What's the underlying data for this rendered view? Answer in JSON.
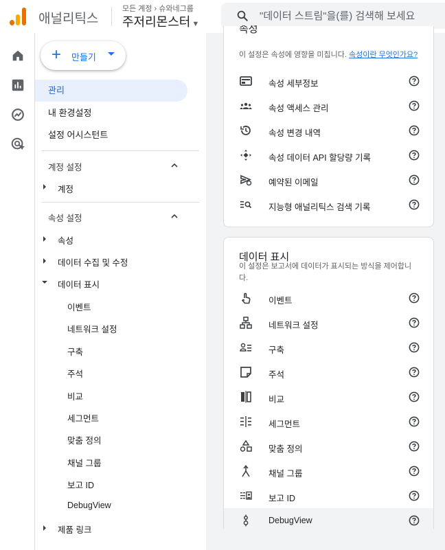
{
  "header": {
    "app_name": "애널리틱스",
    "breadcrumb": {
      "all_accounts": "모든 계정",
      "account": "슈와네그룹"
    },
    "property": "주저리몬스터",
    "search_placeholder": "\"데이터 스트림\"을(를) 검색해 보세요"
  },
  "rail": {
    "items": [
      "home-icon",
      "reports-icon",
      "explore-icon",
      "advertising-icon"
    ]
  },
  "nav": {
    "create_label": "만들기",
    "admin": "관리",
    "my_settings": "내 환경설정",
    "setup_assistant": "설정 어시스턴트",
    "account_settings": {
      "header": "계정 설정",
      "items": [
        "계정"
      ]
    },
    "property_settings": {
      "header": "속성 설정",
      "property": "속성",
      "data_collection": "데이터 수집 및 수정",
      "data_display": "데이터 표시",
      "data_display_items": [
        "이벤트",
        "네트워크 설정",
        "구축",
        "주석",
        "비교",
        "세그먼트",
        "맞춤 정의",
        "채널 그룹",
        "보고 ID",
        "DebugView"
      ],
      "product_links": "제품 링크"
    }
  },
  "property_card": {
    "title": "속성",
    "desc": "이 설정은 속성에 영향을 미칩니다.",
    "link": "속성이란 무엇인가요?",
    "rows": [
      {
        "icon": "property-details-icon",
        "label": "속성 세부정보"
      },
      {
        "icon": "property-access-icon",
        "label": "속성 액세스 관리"
      },
      {
        "icon": "change-history-icon",
        "label": "속성 변경 내역"
      },
      {
        "icon": "api-quota-icon",
        "label": "속성 데이터 API 할당량 기록"
      },
      {
        "icon": "scheduled-email-icon",
        "label": "예약된 이메일"
      },
      {
        "icon": "search-history-icon",
        "label": "지능형 애널리틱스 검색 기록"
      }
    ]
  },
  "display_card": {
    "title": "데이터 표시",
    "desc": "이 설정은 보고서에 데이터가 표시되는 방식을 제어합니다.",
    "rows": [
      {
        "icon": "touch-icon",
        "label": "이벤트"
      },
      {
        "icon": "network-icon",
        "label": "네트워크 설정"
      },
      {
        "icon": "audience-icon",
        "label": "구축"
      },
      {
        "icon": "note-icon",
        "label": "주석"
      },
      {
        "icon": "compare-icon",
        "label": "비교"
      },
      {
        "icon": "segment-icon",
        "label": "세그먼트"
      },
      {
        "icon": "shapes-icon",
        "label": "맞춤 정의"
      },
      {
        "icon": "merge-icon",
        "label": "채널 그룹"
      },
      {
        "icon": "id-icon",
        "label": "보고 ID"
      },
      {
        "icon": "debug-icon",
        "label": "DebugView"
      }
    ]
  }
}
